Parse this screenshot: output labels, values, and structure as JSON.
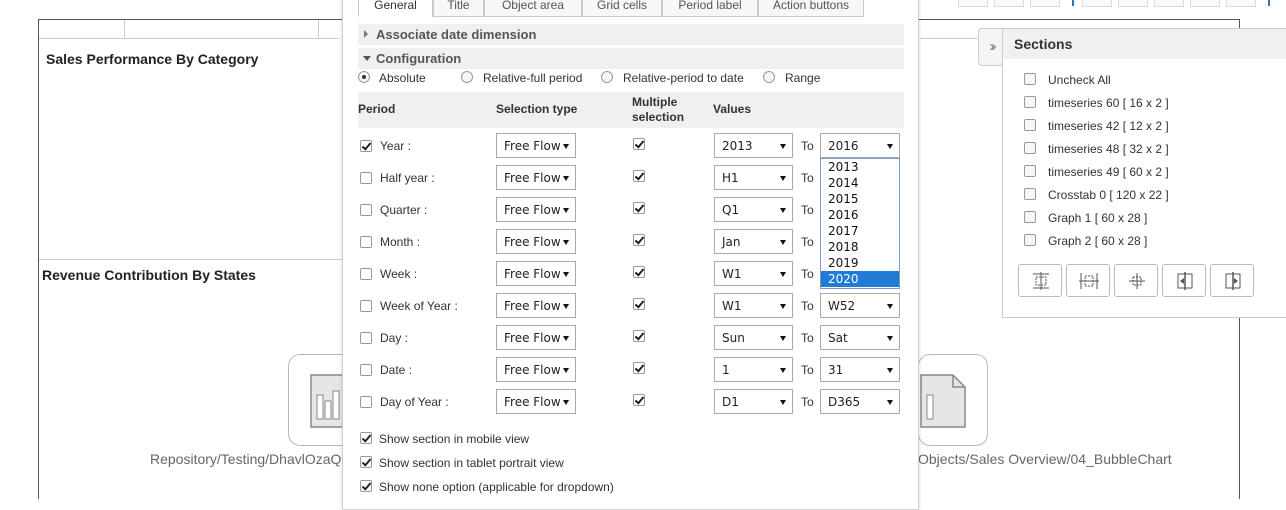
{
  "dialog": {
    "tabs": [
      "General",
      "Title",
      "Object area",
      "Grid cells",
      "Period label",
      "Action buttons"
    ],
    "sections": {
      "associate_date": "Associate date dimension",
      "configuration": "Configuration"
    },
    "mode_options": [
      "Absolute",
      "Relative-full period",
      "Relative-period to date",
      "Range"
    ],
    "selected_mode": "Absolute",
    "columns": {
      "period": "Period",
      "selection_type": "Selection type",
      "multiple_line1": "Multiple",
      "multiple_line2": "selection",
      "values": "Values"
    },
    "to_label": "To",
    "rows": [
      {
        "label": "Year :",
        "checked": true,
        "selection_type": "Free Flow",
        "multi": true,
        "from": "2013",
        "to": "2016"
      },
      {
        "label": "Half year :",
        "checked": false,
        "selection_type": "Free Flow",
        "multi": true,
        "from": "H1",
        "to": ""
      },
      {
        "label": "Quarter :",
        "checked": false,
        "selection_type": "Free Flow",
        "multi": true,
        "from": "Q1",
        "to": ""
      },
      {
        "label": "Month :",
        "checked": false,
        "selection_type": "Free Flow",
        "multi": true,
        "from": "Jan",
        "to": ""
      },
      {
        "label": "Week :",
        "checked": false,
        "selection_type": "Free Flow",
        "multi": true,
        "from": "W1",
        "to": ""
      },
      {
        "label": "Week of Year :",
        "checked": false,
        "selection_type": "Free Flow",
        "multi": true,
        "from": "W1",
        "to": "W52"
      },
      {
        "label": "Day :",
        "checked": false,
        "selection_type": "Free Flow",
        "multi": true,
        "from": "Sun",
        "to": "Sat"
      },
      {
        "label": "Date :",
        "checked": false,
        "selection_type": "Free Flow",
        "multi": true,
        "from": "1",
        "to": "31"
      },
      {
        "label": "Day of Year :",
        "checked": false,
        "selection_type": "Free Flow",
        "multi": true,
        "from": "D1",
        "to": "D365"
      }
    ],
    "year_dropdown_options": [
      "2013",
      "2014",
      "2015",
      "2016",
      "2017",
      "2018",
      "2019",
      "2020"
    ],
    "year_dropdown_highlighted": "2020",
    "options": [
      {
        "label": "Show section in mobile view",
        "checked": true
      },
      {
        "label": "Show section in tablet portrait view",
        "checked": true
      },
      {
        "label": "Show none option (applicable for dropdown)",
        "checked": true
      }
    ]
  },
  "dashboard": {
    "panel1_title": "Sales Performance By Category",
    "panel2_title": "Revenue Contribution By States",
    "path_left": "Repository/Testing/DhavlOzaQ",
    "path_right": "Objects/Sales Overview/04_BubbleChart"
  },
  "sections_panel": {
    "title": "Sections",
    "collapse_icon": "double-chevron-right-icon",
    "items": [
      "Uncheck All",
      "timeseries 60  [ 16 x 2 ]",
      "timeseries 42  [ 12 x 2 ]",
      "timeseries 48  [ 32 x 2 ]",
      "timeseries 49  [ 60 x 2 ]",
      "Crosstab 0  [ 120 x 22 ]",
      "Graph 1  [ 60 x 28 ]",
      "Graph 2  [ 60 x 28 ]"
    ],
    "tools": [
      "distribute-horizontal-icon",
      "distribute-vertical-icon",
      "move-center-icon",
      "align-left-icon",
      "align-right-icon"
    ]
  },
  "colors": {
    "accent": "#1e7bd6",
    "header_bg": "#f0f0f0",
    "border": "#cccccc"
  }
}
